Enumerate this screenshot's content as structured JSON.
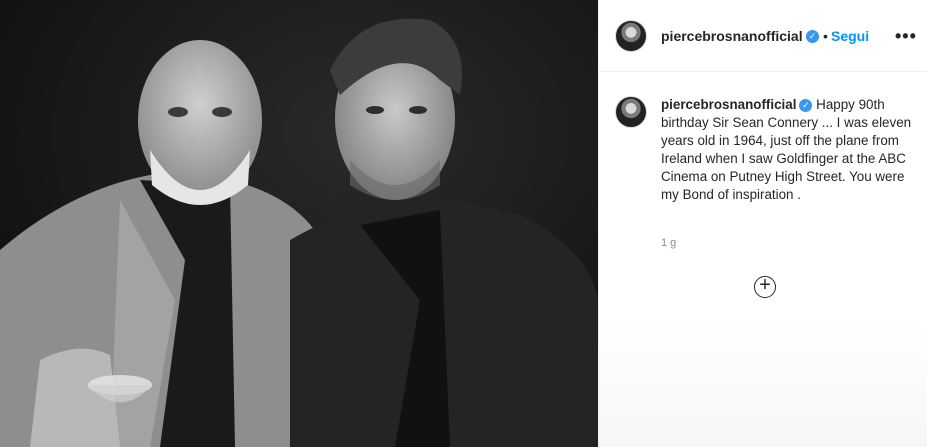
{
  "post": {
    "photo_alt": "black and white photo of two men in suits",
    "icons": {
      "verified": "verified-badge-icon",
      "more": "more-options-icon",
      "load_more": "plus-circle-icon"
    }
  },
  "header": {
    "username": "piercebrosnanofficial",
    "verified_glyph": "✓",
    "separator": "•",
    "follow_label": "Segui",
    "more_glyph": "•••"
  },
  "caption": {
    "username": "piercebrosnanofficial",
    "verified_glyph": "✓",
    "text": "Happy 90th birthday Sir Sean Connery ... I was eleven years old in 1964, just off the plane from Ireland when I saw Goldfinger at the ABC Cinema on Putney High Street. You were my Bond of inspiration ."
  },
  "meta": {
    "time": "1 g",
    "load_more_glyph": "+"
  },
  "colors": {
    "accent": "#0095f6",
    "verified": "#3897f0",
    "text": "#262626",
    "muted": "#8e8e8e"
  }
}
